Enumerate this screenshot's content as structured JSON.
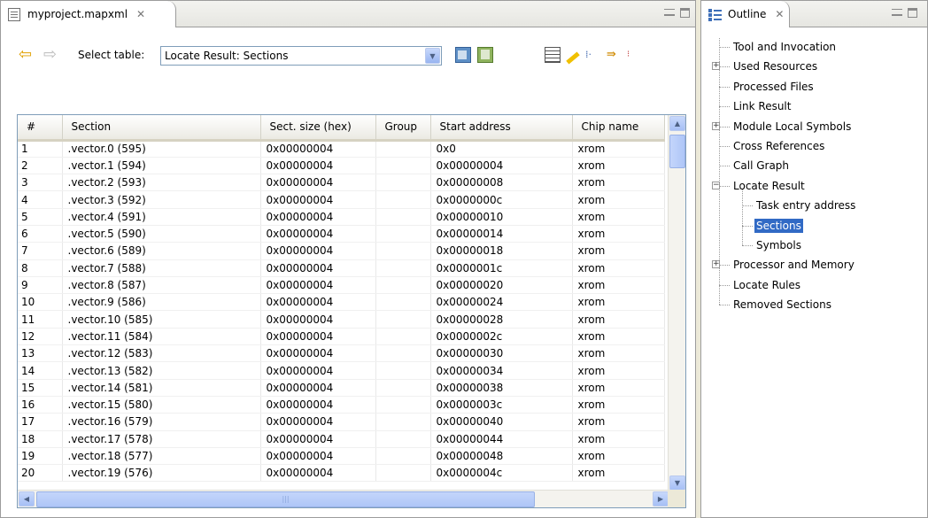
{
  "editor": {
    "tab_title": "myproject.mapxml",
    "tab_close": "✕",
    "toolbar": {
      "back_icon": "⇦",
      "forward_icon": "⇨",
      "select_label": "Select table:",
      "select_value": "Locate Result: Sections",
      "dropdown_glyph": "▼"
    },
    "table": {
      "columns": [
        "#",
        "Section",
        "Sect. size (hex)",
        "Group",
        "Start address",
        "Chip name"
      ],
      "rows": [
        [
          "1",
          ".vector.0 (595)",
          "0x00000004",
          "",
          "0x0",
          "xrom"
        ],
        [
          "2",
          ".vector.1 (594)",
          "0x00000004",
          "",
          "0x00000004",
          "xrom"
        ],
        [
          "3",
          ".vector.2 (593)",
          "0x00000004",
          "",
          "0x00000008",
          "xrom"
        ],
        [
          "4",
          ".vector.3 (592)",
          "0x00000004",
          "",
          "0x0000000c",
          "xrom"
        ],
        [
          "5",
          ".vector.4 (591)",
          "0x00000004",
          "",
          "0x00000010",
          "xrom"
        ],
        [
          "6",
          ".vector.5 (590)",
          "0x00000004",
          "",
          "0x00000014",
          "xrom"
        ],
        [
          "7",
          ".vector.6 (589)",
          "0x00000004",
          "",
          "0x00000018",
          "xrom"
        ],
        [
          "8",
          ".vector.7 (588)",
          "0x00000004",
          "",
          "0x0000001c",
          "xrom"
        ],
        [
          "9",
          ".vector.8 (587)",
          "0x00000004",
          "",
          "0x00000020",
          "xrom"
        ],
        [
          "10",
          ".vector.9 (586)",
          "0x00000004",
          "",
          "0x00000024",
          "xrom"
        ],
        [
          "11",
          ".vector.10 (585)",
          "0x00000004",
          "",
          "0x00000028",
          "xrom"
        ],
        [
          "12",
          ".vector.11 (584)",
          "0x00000004",
          "",
          "0x0000002c",
          "xrom"
        ],
        [
          "13",
          ".vector.12 (583)",
          "0x00000004",
          "",
          "0x00000030",
          "xrom"
        ],
        [
          "14",
          ".vector.13 (582)",
          "0x00000004",
          "",
          "0x00000034",
          "xrom"
        ],
        [
          "15",
          ".vector.14 (581)",
          "0x00000004",
          "",
          "0x00000038",
          "xrom"
        ],
        [
          "16",
          ".vector.15 (580)",
          "0x00000004",
          "",
          "0x0000003c",
          "xrom"
        ],
        [
          "17",
          ".vector.16 (579)",
          "0x00000004",
          "",
          "0x00000040",
          "xrom"
        ],
        [
          "18",
          ".vector.17 (578)",
          "0x00000004",
          "",
          "0x00000044",
          "xrom"
        ],
        [
          "19",
          ".vector.18 (577)",
          "0x00000004",
          "",
          "0x00000048",
          "xrom"
        ],
        [
          "20",
          ".vector.19 (576)",
          "0x00000004",
          "",
          "0x0000004c",
          "xrom"
        ]
      ]
    }
  },
  "outline": {
    "tab_title": "Outline",
    "tab_close": "✕",
    "items": [
      {
        "label": "Tool and Invocation",
        "level": 0,
        "expander": ""
      },
      {
        "label": "Used Resources",
        "level": 0,
        "expander": "+"
      },
      {
        "label": "Processed Files",
        "level": 0,
        "expander": ""
      },
      {
        "label": "Link Result",
        "level": 0,
        "expander": ""
      },
      {
        "label": "Module Local Symbols",
        "level": 0,
        "expander": "+"
      },
      {
        "label": "Cross References",
        "level": 0,
        "expander": ""
      },
      {
        "label": "Call Graph",
        "level": 0,
        "expander": ""
      },
      {
        "label": "Locate Result",
        "level": 0,
        "expander": "−"
      },
      {
        "label": "Task entry address",
        "level": 1,
        "expander": ""
      },
      {
        "label": "Sections",
        "level": 1,
        "expander": "",
        "selected": true
      },
      {
        "label": "Symbols",
        "level": 1,
        "expander": ""
      },
      {
        "label": "Processor and Memory",
        "level": 0,
        "expander": "+"
      },
      {
        "label": "Locate Rules",
        "level": 0,
        "expander": ""
      },
      {
        "label": "Removed Sections",
        "level": 0,
        "expander": ""
      }
    ]
  },
  "colors": {
    "selection": "#316ac5",
    "frame": "#ece9d8",
    "scroll_accent": "#aec6f7"
  }
}
